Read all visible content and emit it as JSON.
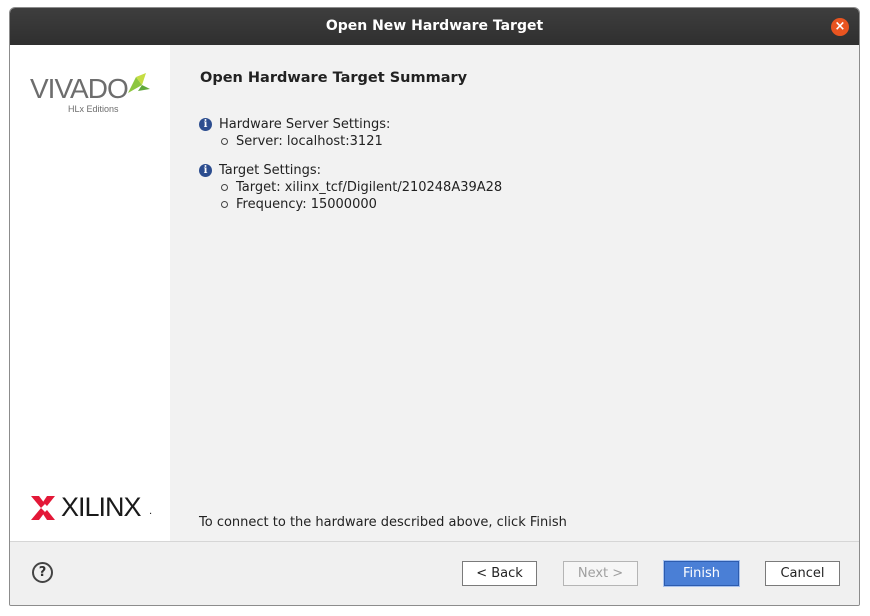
{
  "window": {
    "title": "Open New Hardware Target",
    "close_glyph": "×"
  },
  "branding": {
    "vivado_logo": "VIVADO",
    "vivado_edition": "HLx Editions",
    "xilinx_logo": "XILINX",
    "xilinx_mark": "."
  },
  "summary": {
    "title": "Open Hardware Target Summary",
    "sections": [
      {
        "heading": "Hardware Server Settings:",
        "items": [
          "Server: localhost:3121"
        ]
      },
      {
        "heading": "Target Settings:",
        "items": [
          "Target: xilinx_tcf/Digilent/210248A39A28",
          "Frequency: 15000000"
        ]
      }
    ],
    "footer": "To connect to the hardware described above, click Finish"
  },
  "buttons": {
    "help": "?",
    "back": "< Back",
    "next": "Next >",
    "finish": "Finish",
    "cancel": "Cancel"
  },
  "icons": {
    "info": "info-icon",
    "help": "help-icon",
    "close": "close-icon"
  },
  "colors": {
    "title_bar": "#2f2f2f",
    "close_button": "#e95420",
    "info_icon": "#2c4d8f",
    "primary_button": "#4a7fd6",
    "vivado_leaf": "#8dc63f",
    "xilinx_red": "#e31837"
  }
}
